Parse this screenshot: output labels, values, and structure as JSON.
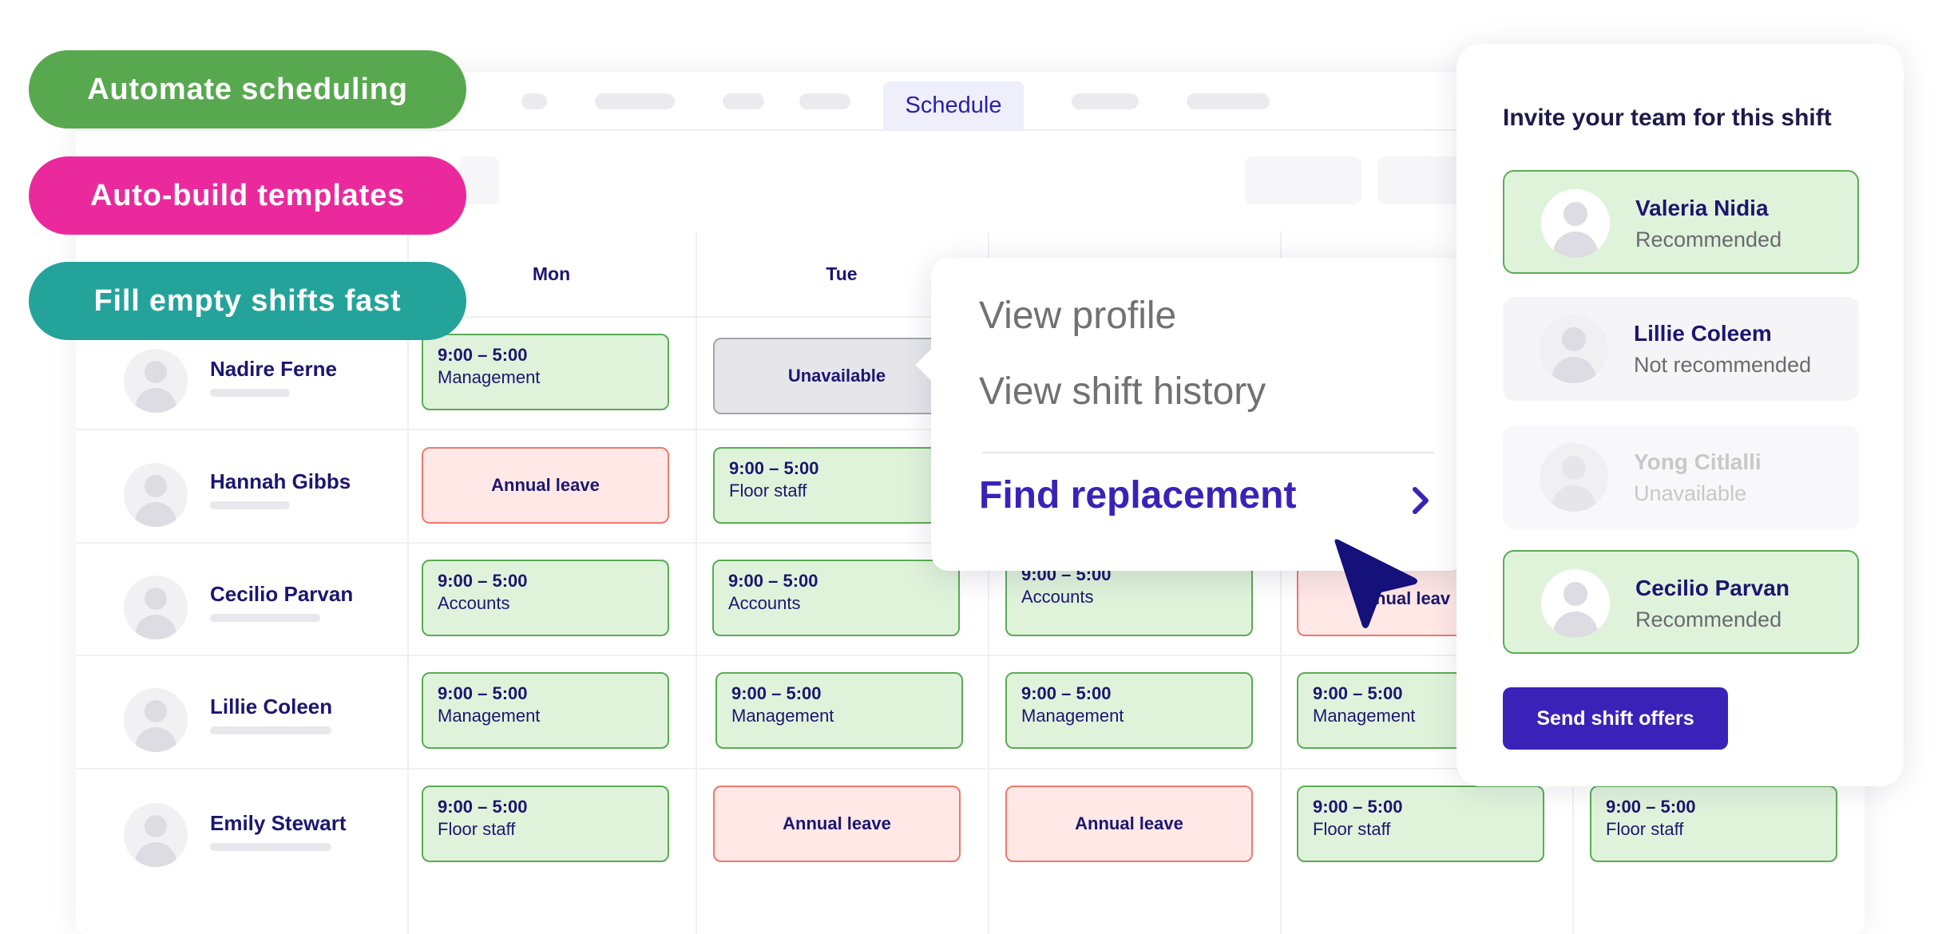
{
  "features": [
    {
      "label": "Automate scheduling",
      "color": "#58a84f"
    },
    {
      "label": "Auto-build templates",
      "color": "#ea2a9c"
    },
    {
      "label": "Fill empty shifts fast",
      "color": "#24a39b"
    }
  ],
  "nav": {
    "active_tab": "Schedule"
  },
  "days": [
    "Mon",
    "Tue"
  ],
  "people": [
    {
      "name": "Nadire Ferne"
    },
    {
      "name": "Hannah Gibbs"
    },
    {
      "name": "Cecilio Parvan"
    },
    {
      "name": "Lillie Coleen"
    },
    {
      "name": "Emily Stewart"
    }
  ],
  "shifts": {
    "time": "9:00 – 5:00",
    "management": "Management",
    "floor_staff": "Floor staff",
    "accounts": "Accounts",
    "annual_leave": "Annual leave",
    "partial_leave": "nual leav",
    "unavailable": "Unavailable"
  },
  "context_menu": {
    "view_profile": "View profile",
    "view_shift_history": "View shift history",
    "find_replacement": "Find replacement"
  },
  "invite_panel": {
    "title": "Invite your team for this shift",
    "candidates": [
      {
        "name": "Valeria Nidia",
        "status": "Recommended"
      },
      {
        "name": "Lillie Coleem",
        "status": "Not recommended"
      },
      {
        "name": "Yong Citlalli",
        "status": "Unavailable"
      },
      {
        "name": "Cecilio Parvan",
        "status": "Recommended"
      }
    ],
    "send_button": "Send shift offers"
  },
  "colors": {
    "accent": "#3a22b9",
    "text_navy": "#1c1670",
    "shift_green_fill": "#dff3db",
    "shift_green_border": "#5bab55",
    "leave_fill": "#ffe8e6",
    "leave_border": "#ee7a6c",
    "cursor": "#14117a"
  }
}
